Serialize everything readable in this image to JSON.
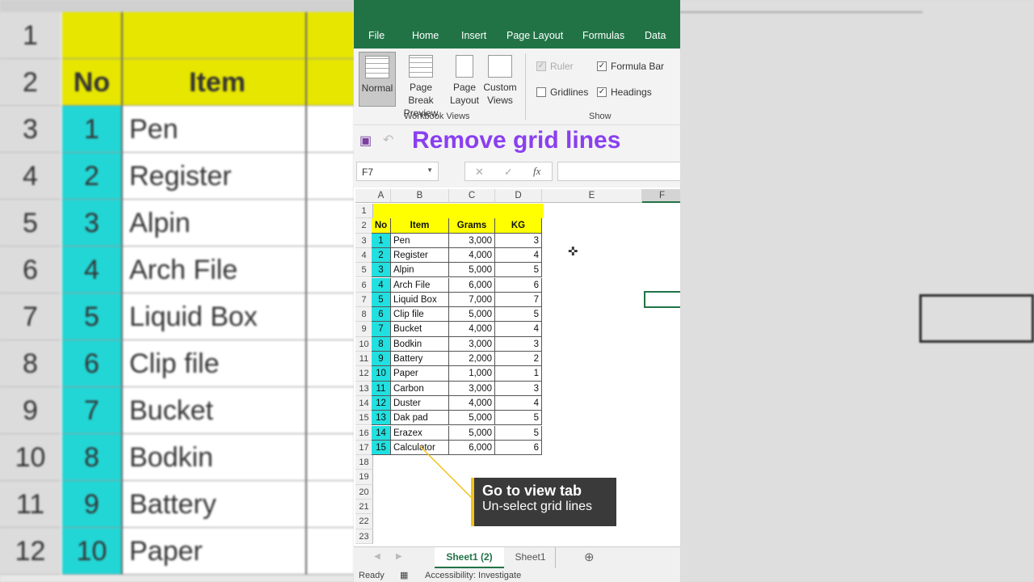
{
  "ribbon_tabs": [
    "File",
    "Home",
    "Insert",
    "Page Layout",
    "Formulas",
    "Data"
  ],
  "workbook_views": {
    "buttons": [
      [
        "Normal",
        ""
      ],
      [
        "Page Break",
        "Preview"
      ],
      [
        "Page",
        "Layout"
      ],
      [
        "Custom",
        "Views"
      ]
    ],
    "group_label": "Workbook Views"
  },
  "show": {
    "ruler": "Ruler",
    "formula_bar": "Formula Bar",
    "gridlines": "Gridlines",
    "headings": "Headings",
    "group_label": "Show",
    "checked": {
      "ruler": true,
      "formula_bar": true,
      "gridlines": false,
      "headings": true
    }
  },
  "overlay_title": "Remove grid lines",
  "name_box": "F7",
  "formula_icons": {
    "cancel": "✕",
    "enter": "✓",
    "fx": "fx"
  },
  "columns": [
    "A",
    "B",
    "C",
    "D",
    "E",
    "F"
  ],
  "headers": {
    "no": "No",
    "item": "Item",
    "grams": "Grams",
    "kg": "KG"
  },
  "rows": [
    [
      1,
      "Pen",
      "3,000",
      3
    ],
    [
      2,
      "Register",
      "4,000",
      4
    ],
    [
      3,
      "Alpin",
      "5,000",
      5
    ],
    [
      4,
      "Arch File",
      "6,000",
      6
    ],
    [
      5,
      "Liquid Box",
      "7,000",
      7
    ],
    [
      6,
      "Clip file",
      "5,000",
      5
    ],
    [
      7,
      "Bucket",
      "4,000",
      4
    ],
    [
      8,
      "Bodkin",
      "3,000",
      3
    ],
    [
      9,
      "Battery",
      "2,000",
      2
    ],
    [
      10,
      "Paper",
      "1,000",
      1
    ],
    [
      11,
      "Carbon",
      "3,000",
      3
    ],
    [
      12,
      "Duster",
      "4,000",
      4
    ],
    [
      13,
      "Dak pad",
      "5,000",
      5
    ],
    [
      14,
      "Erazex",
      "5,000",
      5
    ],
    [
      15,
      "Calculator",
      "6,000",
      6
    ]
  ],
  "callout": {
    "title": "Go to view tab",
    "subtitle": "Un-select grid lines"
  },
  "sheet_tabs": [
    "Sheet1 (2)",
    "Sheet1"
  ],
  "status": {
    "ready": "Ready",
    "accessibility": "Accessibility: Investigate"
  },
  "colors": {
    "green": "#217346",
    "yellow": "#ffff00",
    "cyan": "#22e0e0",
    "purple": "#8a3ff0"
  }
}
